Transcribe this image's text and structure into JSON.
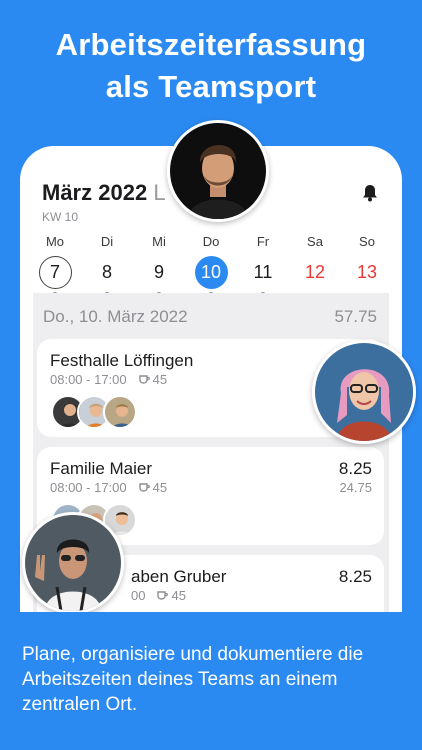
{
  "headline": {
    "line1": "Arbeitszeiterfassung",
    "line2": "als Teamsport"
  },
  "calendar": {
    "month": "März 2022",
    "month_extra": "L",
    "week": "KW 10",
    "bell_icon": "bell-icon",
    "days": [
      {
        "name": "Mo",
        "num": "7"
      },
      {
        "name": "Di",
        "num": "8"
      },
      {
        "name": "Mi",
        "num": "9"
      },
      {
        "name": "Do",
        "num": "10"
      },
      {
        "name": "Fr",
        "num": "11"
      },
      {
        "name": "Sa",
        "num": "12"
      },
      {
        "name": "So",
        "num": "13"
      }
    ]
  },
  "list": {
    "date": "Do., 10. März 2022",
    "total": "57.75",
    "entries": [
      {
        "title": "Festhalle Löffingen",
        "time": "08:00 - 17:00",
        "break": "45",
        "hours": "",
        "sub": ""
      },
      {
        "title": "Familie Maier",
        "time": "08:00 - 17:00",
        "break": "45",
        "hours": "8.25",
        "sub": "24.75"
      },
      {
        "title": "aben Gruber",
        "time": "00",
        "break": "45",
        "hours": "8.25",
        "sub": ""
      }
    ]
  },
  "colors": {
    "accent": "#2b8af2",
    "weekend": "#e53935",
    "background": "#eeeef0"
  },
  "footer": {
    "text": "Plane, organisiere und dokumentiere die Arbeitszeiten deines Teams an einem zentralen Ort."
  }
}
